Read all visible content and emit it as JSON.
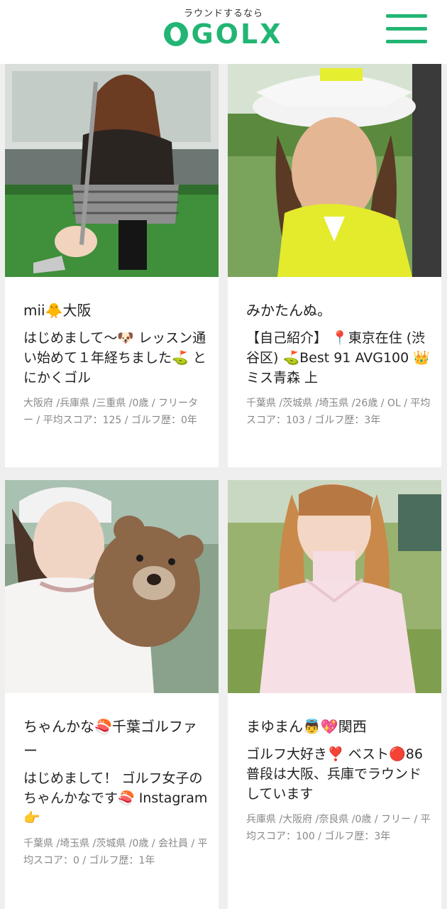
{
  "header": {
    "tagline": "ラウンドするなら",
    "logo_text": "GOLX",
    "brand_color": "#22b573",
    "menu_icon": "hamburger-menu-icon"
  },
  "cards": [
    {
      "name": "mii🐥大阪",
      "intro": "はじめまして〜🐶 レッスン通い始めて１年経ちました⛳ とにかくゴル",
      "meta": "大阪府 /兵庫県 /三重県 /0歳 / フリーター / 平均スコア：125 / ゴルフ歴：0年"
    },
    {
      "name": "みかたんぬ。",
      "intro": "【自己紹介】 📍東京在住 (渋谷区) ⛳Best 91 AVG100 👑ミス青森 上",
      "meta": "千葉県 /茨城県 /埼玉県 /26歳 / OL / 平均スコア：103 / ゴルフ歴：3年"
    },
    {
      "name": "ちゃんかな🍣千葉ゴルファー",
      "intro": "はじめまして！ ゴルフ女子のちゃんかなです🍣 Instagram👉",
      "meta": "千葉県 /埼玉県 /茨城県 /0歳 / 会社員 / 平均スコア：0 / ゴルフ歴：1年"
    },
    {
      "name": "まゆまん👼💖関西",
      "intro": "ゴルフ大好き❣️ ベスト🔴86 普段は大阪、兵庫でラウンドしています",
      "meta": "兵庫県 /大阪府 /奈良県 /0歳 / フリー / 平均スコア：100 / ゴルフ歴：3年"
    }
  ]
}
